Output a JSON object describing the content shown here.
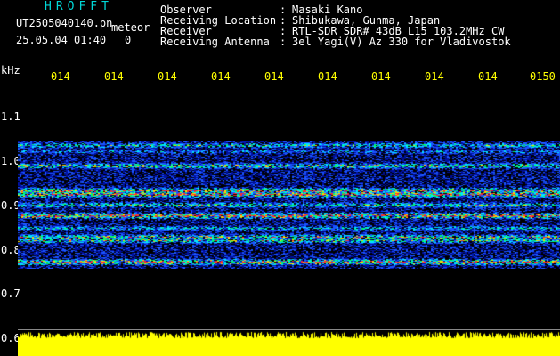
{
  "header": {
    "app_title": "HROFFT",
    "file_name": "UT2505040140.pn",
    "meteor_label": "meteor",
    "datetime": "25.05.04 01:40",
    "zero": "0"
  },
  "info": [
    {
      "label": "Observer",
      "value": "Masaki Kano"
    },
    {
      "label": "Receiving Location",
      "value": "Shibukawa, Gunma, Japan"
    },
    {
      "label": "Receiver",
      "value": "RTL-SDR SDR# 43dB L15 103.2MHz CW"
    },
    {
      "label": "Receiving Antenna",
      "value": "3el Yagi(V) Az 330 for Vladivostok"
    }
  ],
  "axis": {
    "unit": "kHz",
    "y_labels": [
      "1.1",
      "1.0",
      "0.9",
      "0.8",
      "0.7",
      "0.6"
    ],
    "x_ticks": [
      "014",
      "014",
      "014",
      "014",
      "014",
      "014",
      "014",
      "014",
      "014",
      "0150"
    ]
  },
  "colors": {
    "background": "#000000",
    "title": "#00d8d8",
    "tick": "#ffff00",
    "noise_low": "#0000cc",
    "noise_mid": "#00ffff",
    "noise_high": "#ff2222",
    "bottom_bar": "#ffff00"
  }
}
